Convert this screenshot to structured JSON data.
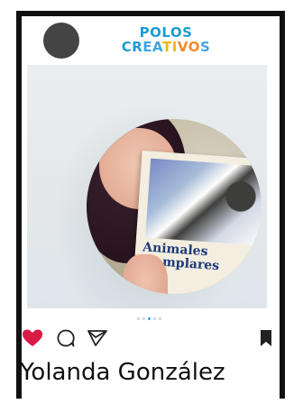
{
  "header": {
    "brand_line1": "POLOS",
    "brand_line2": [
      "C",
      "R",
      "E",
      "A",
      "T",
      "I",
      "V",
      "O",
      "S"
    ]
  },
  "post": {
    "poster_title_line1": "Animales",
    "poster_title_line2": "ejemplares",
    "carousel_total": 5,
    "carousel_active": 2
  },
  "actions": {
    "liked": true,
    "like_color": "#d91a45"
  },
  "author": {
    "name": "Yolanda González"
  }
}
